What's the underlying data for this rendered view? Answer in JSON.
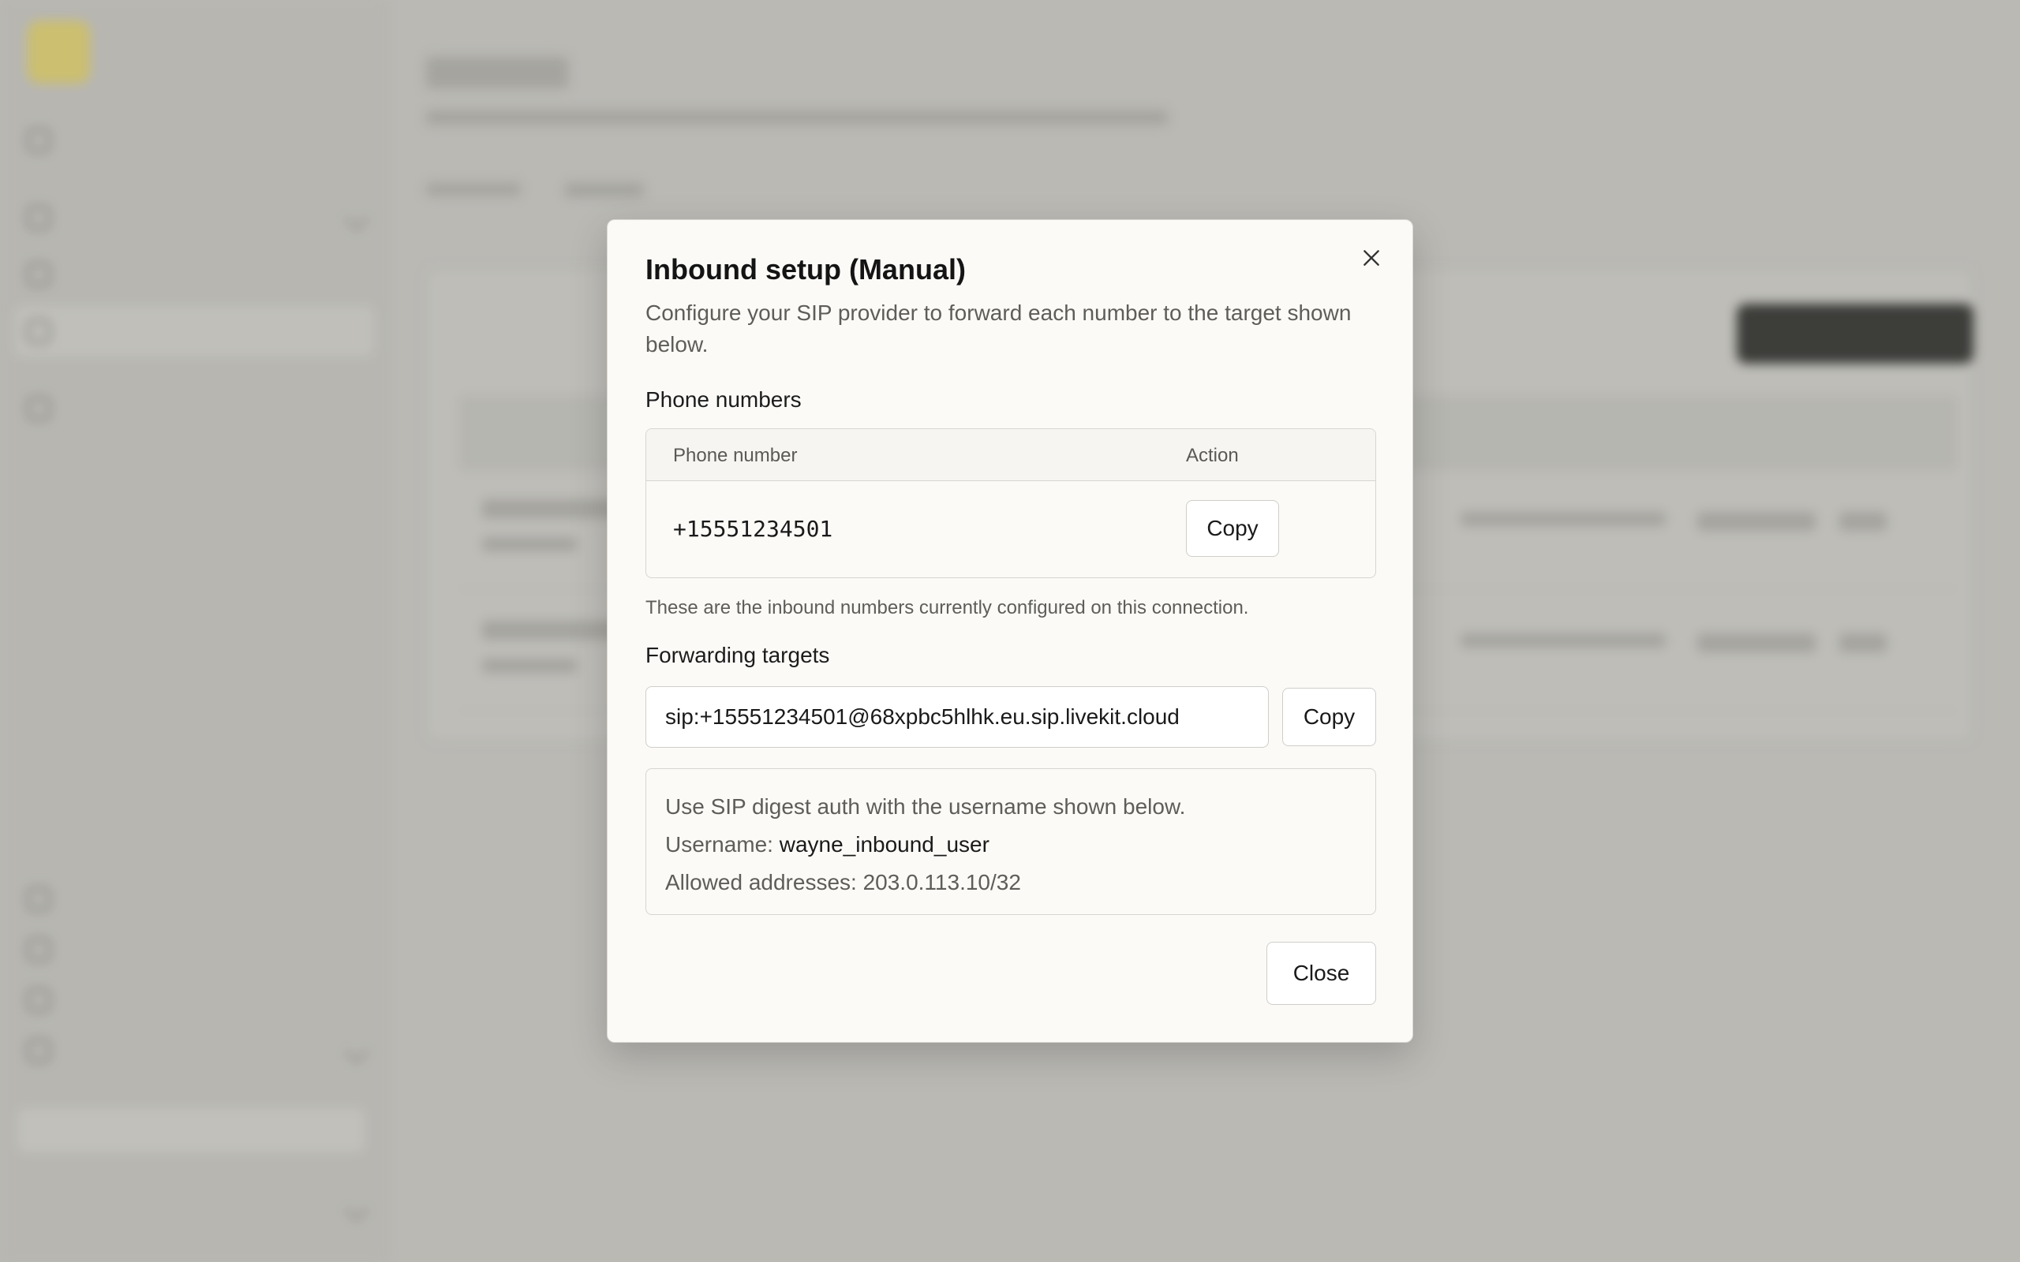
{
  "modal": {
    "title": "Inbound setup (Manual)",
    "description": "Configure your SIP provider to forward each number to the target shown below.",
    "close_icon": "close-icon",
    "phone_section_label": "Phone numbers",
    "phone_table": {
      "headers": {
        "number": "Phone number",
        "action": "Action"
      },
      "rows": [
        {
          "number": "+15551234501",
          "action_label": "Copy"
        }
      ]
    },
    "phone_helper": "These are the inbound numbers currently configured on this connection.",
    "targets_label": "Forwarding targets",
    "target_value": "sip:+15551234501@68xpbc5hlhk.eu.sip.livekit.cloud",
    "target_copy_label": "Copy",
    "auth": {
      "note": "Use SIP digest auth with the username shown below.",
      "username_label": "Username:",
      "username_value": "wayne_inbound_user",
      "allowed_label": "Allowed addresses:",
      "allowed_value": "203.0.113.10/32"
    },
    "close_button_label": "Close"
  },
  "colors": {
    "overlay": "#c2c1bc",
    "modal_bg": "#fbfaf7",
    "logo_accent": "#d8c86a"
  }
}
